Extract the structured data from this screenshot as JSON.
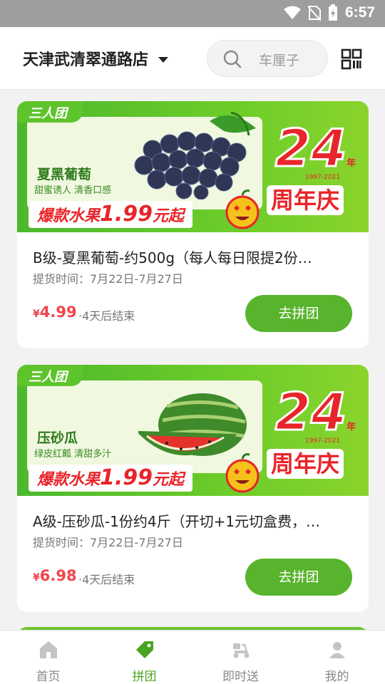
{
  "status_bar": {
    "time": "6:57"
  },
  "header": {
    "store_name": "天津武清翠通路店",
    "search_placeholder": "车厘子"
  },
  "products": [
    {
      "banner": {
        "group_tag": "三人团",
        "fruit_name": "夏黑葡萄",
        "fruit_slogan": "甜蜜诱人 清香口感",
        "promo_prefix": "爆款水果",
        "promo_price": "1.99",
        "promo_suffix": "元起",
        "anniv_number": "24",
        "anniv_unit": "年",
        "anniv_years": "1997-2021",
        "anniv_text": "周年庆"
      },
      "name": "B级-夏黑葡萄-约500g（每人每日限提2份…",
      "pickup": "提货时间：7月22日-7月27日",
      "currency": "¥",
      "price": "4.99",
      "ends": "·4天后结束",
      "button": "去拼团"
    },
    {
      "banner": {
        "group_tag": "三人团",
        "fruit_name": "压砂瓜",
        "fruit_slogan": "绿皮红瓤 清甜多汁",
        "promo_prefix": "爆款水果",
        "promo_price": "1.99",
        "promo_suffix": "元起",
        "anniv_number": "24",
        "anniv_unit": "年",
        "anniv_years": "1997-2021",
        "anniv_text": "周年庆"
      },
      "name": "A级-压砂瓜-1份约4斤（开切+1元切盒费，…",
      "pickup": "提货时间：7月22日-7月27日",
      "currency": "¥",
      "price": "6.98",
      "ends": "·4天后结束",
      "button": "去拼团"
    }
  ],
  "tabbar": {
    "active_color": "#4aa423",
    "tabs": [
      {
        "label": "首页",
        "icon": "home-icon"
      },
      {
        "label": "拼团",
        "icon": "tag-icon"
      },
      {
        "label": "即时送",
        "icon": "scooter-icon"
      },
      {
        "label": "我的",
        "icon": "person-icon"
      }
    ]
  }
}
